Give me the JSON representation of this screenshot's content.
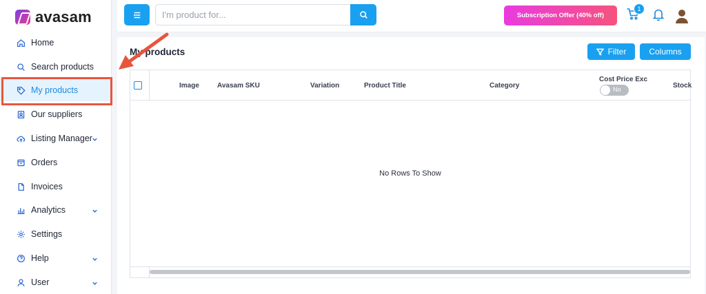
{
  "brand": {
    "name": "avasam"
  },
  "sidebar": {
    "items": [
      {
        "label": "Home",
        "icon": "home-icon"
      },
      {
        "label": "Search products",
        "icon": "search-icon"
      },
      {
        "label": "My products",
        "icon": "tag-icon",
        "active": true
      },
      {
        "label": "Our suppliers",
        "icon": "contacts-icon"
      },
      {
        "label": "Listing Manager",
        "icon": "cloud-upload-icon",
        "expandable": true
      },
      {
        "label": "Orders",
        "icon": "box-icon"
      },
      {
        "label": "Invoices",
        "icon": "file-icon"
      },
      {
        "label": "Analytics",
        "icon": "bar-chart-icon",
        "expandable": true
      },
      {
        "label": "Settings",
        "icon": "gear-icon"
      },
      {
        "label": "Help",
        "icon": "help-circle-icon",
        "expandable": true
      },
      {
        "label": "User",
        "icon": "user-icon",
        "expandable": true
      }
    ]
  },
  "header": {
    "search": {
      "placeholder": "I'm product for...",
      "value": ""
    },
    "offer_label": "Subscription Offer (40% off)",
    "cart_count": "1"
  },
  "main": {
    "title": "My products",
    "filter_label": "Filter",
    "columns_label": "Columns",
    "grid": {
      "columns": [
        "Image",
        "Avasam SKU",
        "Variation",
        "Product Title",
        "Category",
        "Cost Price Exc",
        "Stock"
      ],
      "cost_toggle_label": "No",
      "empty_message": "No Rows To Show"
    }
  },
  "colors": {
    "accent": "#1aa0f0",
    "active_bg": "#e4f3fd",
    "highlight": "#e8553d",
    "offer_start": "#e93be0",
    "offer_end": "#f5537d"
  }
}
